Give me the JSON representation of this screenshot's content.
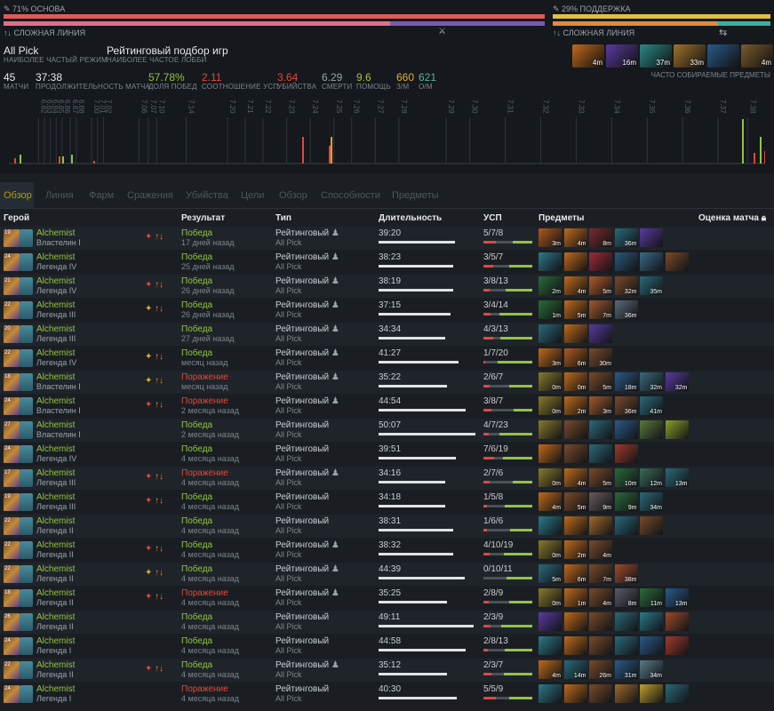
{
  "summary": {
    "core_pct": "71% ОСНОВА",
    "support_pct": "29% ПОДДЕРЖКА",
    "lane_left": "СЛОЖНАЯ ЛИНИЯ",
    "lane_right": "СЛОЖНАЯ ЛИНИЯ",
    "mode": "All Pick",
    "mode_sub": "НАИБОЛЕЕ ЧАСТЫЙ РЕЖИМ",
    "lobby": "Рейтинговый подбор игр",
    "lobby_sub": "НАИБОЛЕЕ ЧАСТОЕ ЛОББИ",
    "popular_items_label": "ЧАСТО СОБИРАЕМЫЕ ПРЕДМЕТЫ",
    "popular_items": [
      {
        "time": "4m",
        "color": "#c06a1a"
      },
      {
        "time": "16m",
        "color": "#5a3aa0"
      },
      {
        "time": "37m",
        "color": "#2a8a8a"
      },
      {
        "time": "33m",
        "color": "#a0742a"
      },
      {
        "time": "",
        "color": "#2a5a8a"
      },
      {
        "time": "4m",
        "color": "#7a5a2a"
      }
    ],
    "stats": [
      {
        "value": "45",
        "label": "МАТЧИ",
        "color": "#e6e9ec"
      },
      {
        "value": "37:38",
        "label": "ПРОДОЛЖИТЕЛЬНОСТЬ МАТЧА",
        "color": "#e6e9ec"
      },
      {
        "value": "57.78%",
        "label": "ДОЛЯ ПОБЕД",
        "color": "#92c442"
      },
      {
        "value": "2.11",
        "label": "СООТНОШЕНИЕ УСП",
        "color": "#e0483c"
      },
      {
        "value": "3.64",
        "label": "УБИЙСТВА",
        "color": "#e0483c"
      },
      {
        "value": "6.29",
        "label": "СМЕРТИ",
        "color": "#9aa3ad"
      },
      {
        "value": "9.6",
        "label": "ПОМОЩЬ",
        "color": "#aac03a"
      },
      {
        "value": "660",
        "label": "З/М",
        "color": "#e0b030"
      },
      {
        "value": "621",
        "label": "О/М",
        "color": "#5ab0a0"
      }
    ],
    "versions": [
      "6.82",
      "6.83",
      "6.84",
      "6.85",
      "6.86",
      "6.87",
      "6.88",
      "7.00",
      "7.01",
      "7.02",
      "7.06",
      "7.07",
      "7.10",
      "7.14",
      "7.20",
      "7.21",
      "7.22",
      "7.23",
      "7.24",
      "7.25",
      "7.26",
      "7.27",
      "7.28",
      "7.29",
      "7.30",
      "7.31",
      "7.32",
      "7.33",
      "7.34",
      "7.35",
      "7.36",
      "7.37",
      "7.38"
    ]
  },
  "tabs": [
    "Обзор",
    "Линия",
    "Фарм",
    "Сражения",
    "Убийства",
    "Цели",
    "Обзор",
    "Способности",
    "Предметы"
  ],
  "columns": {
    "hero": "Герой",
    "result": "Результат",
    "type": "Тип",
    "duration": "Длительность",
    "kda": "УСП",
    "items": "Предметы",
    "rating": "Оценка матча"
  },
  "matches": [
    {
      "level": "19",
      "hero": "Alchemist",
      "rank": "Властелин I",
      "role": "red",
      "result": "Победа",
      "win": true,
      "when": "17 дней назад",
      "type": "Рейтинговый",
      "party": true,
      "lobby": "All Pick",
      "duration": "39:20",
      "dur_frac": 0.78,
      "kda": "5/7/8",
      "items": [
        {
          "t": "3m",
          "c": "#b05a1a"
        },
        {
          "t": "4m",
          "c": "#c06a1a"
        },
        {
          "t": "8m",
          "c": "#7a2a2a"
        },
        {
          "t": "36m",
          "c": "#2a6a7a"
        },
        {
          "t": "",
          "c": "#5a3aa0"
        }
      ]
    },
    {
      "level": "24",
      "hero": "Alchemist",
      "rank": "Легенда IV",
      "role": "",
      "result": "Победа",
      "win": true,
      "when": "25 дней назад",
      "type": "Рейтинговый",
      "party": true,
      "lobby": "All Pick",
      "duration": "38:23",
      "dur_frac": 0.76,
      "kda": "3/5/7",
      "items": [
        {
          "t": "",
          "c": "#2a7a8a"
        },
        {
          "t": "",
          "c": "#c06a1a"
        },
        {
          "t": "",
          "c": "#a02a3a"
        },
        {
          "t": "",
          "c": "#2a5a7a"
        },
        {
          "t": "",
          "c": "#3a6a8a"
        },
        {
          "t": "",
          "c": "#7a4a2a"
        }
      ]
    },
    {
      "level": "21",
      "hero": "Alchemist",
      "rank": "Легенда IV",
      "role": "red",
      "result": "Победа",
      "win": true,
      "when": "26 дней назад",
      "type": "Рейтинговый",
      "party": true,
      "lobby": "All Pick",
      "duration": "38:19",
      "dur_frac": 0.76,
      "kda": "3/8/13",
      "items": [
        {
          "t": "2m",
          "c": "#2a6a3a"
        },
        {
          "t": "4m",
          "c": "#c06a1a"
        },
        {
          "t": "5m",
          "c": "#b05a2a"
        },
        {
          "t": "32m",
          "c": "#7a4a2a"
        },
        {
          "t": "35m",
          "c": "#2a6a7a"
        }
      ]
    },
    {
      "level": "22",
      "hero": "Alchemist",
      "rank": "Легенда III",
      "role": "yellow",
      "result": "Победа",
      "win": true,
      "when": "26 дней назад",
      "type": "Рейтинговый",
      "party": true,
      "lobby": "All Pick",
      "duration": "37:15",
      "dur_frac": 0.74,
      "kda": "3/4/14",
      "items": [
        {
          "t": "1m",
          "c": "#2a6a3a"
        },
        {
          "t": "5m",
          "c": "#c06a1a"
        },
        {
          "t": "7m",
          "c": "#a05a2a"
        },
        {
          "t": "36m",
          "c": "#5a6a7a"
        }
      ]
    },
    {
      "level": "20",
      "hero": "Alchemist",
      "rank": "Легенда III",
      "role": "",
      "result": "Победа",
      "win": true,
      "when": "27 дней назад",
      "type": "Рейтинговый",
      "party": true,
      "lobby": "All Pick",
      "duration": "34:34",
      "dur_frac": 0.68,
      "kda": "4/3/13",
      "items": [
        {
          "t": "",
          "c": "#2a6a7a"
        },
        {
          "t": "",
          "c": "#c06a1a"
        },
        {
          "t": "",
          "c": "#5a3aa0"
        }
      ]
    },
    {
      "level": "22",
      "hero": "Alchemist",
      "rank": "Легенда IV",
      "role": "yellow",
      "result": "Победа",
      "win": true,
      "when": "месяц назад",
      "type": "Рейтинговый",
      "party": true,
      "lobby": "All Pick",
      "duration": "41:27",
      "dur_frac": 0.82,
      "kda": "1/7/20",
      "items": [
        {
          "t": "3m",
          "c": "#c06a1a"
        },
        {
          "t": "6m",
          "c": "#b05a1a"
        },
        {
          "t": "30m",
          "c": "#7a4a2a"
        }
      ]
    },
    {
      "level": "18",
      "hero": "Alchemist",
      "rank": "Властелин I",
      "role": "yellow",
      "result": "Поражение",
      "win": false,
      "when": "месяц назад",
      "type": "Рейтинговый",
      "party": true,
      "lobby": "All Pick",
      "duration": "35:22",
      "dur_frac": 0.7,
      "kda": "2/6/7",
      "items": [
        {
          "t": "0m",
          "c": "#8a7a2a"
        },
        {
          "t": "0m",
          "c": "#c06a1a"
        },
        {
          "t": "5m",
          "c": "#7a4a2a"
        },
        {
          "t": "18m",
          "c": "#2a5a8a"
        },
        {
          "t": "32m",
          "c": "#3a6a7a"
        },
        {
          "t": "32m",
          "c": "#5a3aa0"
        }
      ]
    },
    {
      "level": "24",
      "hero": "Alchemist",
      "rank": "Властелин I",
      "role": "red",
      "result": "Поражение",
      "win": false,
      "when": "2 месяца назад",
      "type": "Рейтинговый",
      "party": true,
      "lobby": "All Pick",
      "duration": "44:54",
      "dur_frac": 0.89,
      "kda": "3/8/7",
      "items": [
        {
          "t": "0m",
          "c": "#8a7a2a"
        },
        {
          "t": "2m",
          "c": "#c06a1a"
        },
        {
          "t": "3m",
          "c": "#a05a2a"
        },
        {
          "t": "36m",
          "c": "#7a4a2a"
        },
        {
          "t": "41m",
          "c": "#2a6a7a"
        }
      ]
    },
    {
      "level": "27",
      "hero": "Alchemist",
      "rank": "Властелин I",
      "role": "",
      "result": "Победа",
      "win": true,
      "when": "2 месяца назад",
      "type": "Рейтинговый",
      "party": false,
      "lobby": "All Pick",
      "duration": "50:07",
      "dur_frac": 0.99,
      "kda": "4/7/23",
      "items": [
        {
          "t": "",
          "c": "#8a7a2a"
        },
        {
          "t": "",
          "c": "#7a4a2a"
        },
        {
          "t": "",
          "c": "#2a6a7a"
        },
        {
          "t": "",
          "c": "#2a5a8a"
        },
        {
          "t": "",
          "c": "#5a7a3a"
        },
        {
          "t": "",
          "c": "#8aa02a"
        }
      ]
    },
    {
      "level": "24",
      "hero": "Alchemist",
      "rank": "Легенда IV",
      "role": "",
      "result": "Победа",
      "win": true,
      "when": "4 месяца назад",
      "type": "Рейтинговый",
      "party": false,
      "lobby": "All Pick",
      "duration": "39:51",
      "dur_frac": 0.79,
      "kda": "7/6/19",
      "items": [
        {
          "t": "",
          "c": "#c06a1a"
        },
        {
          "t": "",
          "c": "#7a4a2a"
        },
        {
          "t": "",
          "c": "#2a6a7a"
        },
        {
          "t": "",
          "c": "#a03a2a"
        }
      ]
    },
    {
      "level": "17",
      "hero": "Alchemist",
      "rank": "Легенда III",
      "role": "red",
      "result": "Поражение",
      "win": false,
      "when": "4 месяца назад",
      "type": "Рейтинговый",
      "party": true,
      "lobby": "All Pick",
      "duration": "34:16",
      "dur_frac": 0.68,
      "kda": "2/7/6",
      "items": [
        {
          "t": "0m",
          "c": "#8a7a2a"
        },
        {
          "t": "4m",
          "c": "#c06a1a"
        },
        {
          "t": "5m",
          "c": "#7a4a2a"
        },
        {
          "t": "10m",
          "c": "#2a6a3a"
        },
        {
          "t": "12m",
          "c": "#3a6a5a"
        },
        {
          "t": "13m",
          "c": "#2a6a7a"
        }
      ]
    },
    {
      "level": "19",
      "hero": "Alchemist",
      "rank": "Легенда III",
      "role": "red",
      "result": "Победа",
      "win": true,
      "when": "4 месяца назад",
      "type": "Рейтинговый",
      "party": false,
      "lobby": "All Pick",
      "duration": "34:18",
      "dur_frac": 0.68,
      "kda": "1/5/8",
      "items": [
        {
          "t": "4m",
          "c": "#c06a1a"
        },
        {
          "t": "5m",
          "c": "#7a4a2a"
        },
        {
          "t": "9m",
          "c": "#6a5a5a"
        },
        {
          "t": "9m",
          "c": "#2a6a3a"
        },
        {
          "t": "34m",
          "c": "#2a6a7a"
        }
      ]
    },
    {
      "level": "22",
      "hero": "Alchemist",
      "rank": "Легенда II",
      "role": "",
      "result": "Победа",
      "win": true,
      "when": "4 месяца назад",
      "type": "Рейтинговый",
      "party": false,
      "lobby": "All Pick",
      "duration": "38:31",
      "dur_frac": 0.76,
      "kda": "1/6/6",
      "items": [
        {
          "t": "",
          "c": "#2a7a8a"
        },
        {
          "t": "",
          "c": "#c06a1a"
        },
        {
          "t": "",
          "c": "#a06a2a"
        },
        {
          "t": "",
          "c": "#2a6a7a"
        },
        {
          "t": "",
          "c": "#7a4a2a"
        }
      ]
    },
    {
      "level": "22",
      "hero": "Alchemist",
      "rank": "Легенда II",
      "role": "red",
      "result": "Победа",
      "win": true,
      "when": "4 месяца назад",
      "type": "Рейтинговый",
      "party": true,
      "lobby": "All Pick",
      "duration": "38:32",
      "dur_frac": 0.76,
      "kda": "4/10/19",
      "items": [
        {
          "t": "0m",
          "c": "#8a7a2a"
        },
        {
          "t": "2m",
          "c": "#c06a1a"
        },
        {
          "t": "4m",
          "c": "#7a4a2a"
        }
      ]
    },
    {
      "level": "22",
      "hero": "Alchemist",
      "rank": "Легенда II",
      "role": "yellow",
      "result": "Победа",
      "win": true,
      "when": "4 месяца назад",
      "type": "Рейтинговый",
      "party": true,
      "lobby": "All Pick",
      "duration": "44:39",
      "dur_frac": 0.88,
      "kda": "0/10/11",
      "items": [
        {
          "t": "5m",
          "c": "#2a6a7a"
        },
        {
          "t": "6m",
          "c": "#c06a1a"
        },
        {
          "t": "7m",
          "c": "#7a4a2a"
        },
        {
          "t": "38m",
          "c": "#a04a2a"
        }
      ]
    },
    {
      "level": "18",
      "hero": "Alchemist",
      "rank": "Легенда II",
      "role": "red",
      "result": "Поражение",
      "win": false,
      "when": "4 месяца назад",
      "type": "Рейтинговый",
      "party": true,
      "lobby": "All Pick",
      "duration": "35:25",
      "dur_frac": 0.7,
      "kda": "2/8/9",
      "items": [
        {
          "t": "0m",
          "c": "#8a7a2a"
        },
        {
          "t": "1m",
          "c": "#c06a1a"
        },
        {
          "t": "4m",
          "c": "#7a4a2a"
        },
        {
          "t": "8m",
          "c": "#5a5a6a"
        },
        {
          "t": "11m",
          "c": "#2a6a3a"
        },
        {
          "t": "13m",
          "c": "#2a5a8a"
        }
      ]
    },
    {
      "level": "26",
      "hero": "Alchemist",
      "rank": "Легенда II",
      "role": "",
      "result": "Победа",
      "win": true,
      "when": "4 месяца назад",
      "type": "Рейтинговый",
      "party": false,
      "lobby": "All Pick",
      "duration": "49:11",
      "dur_frac": 0.97,
      "kda": "2/3/9",
      "items": [
        {
          "t": "",
          "c": "#5a3aa0"
        },
        {
          "t": "",
          "c": "#c06a1a"
        },
        {
          "t": "",
          "c": "#7a4a2a"
        },
        {
          "t": "",
          "c": "#2a6a7a"
        },
        {
          "t": "",
          "c": "#2a7a8a"
        },
        {
          "t": "",
          "c": "#a04a2a"
        }
      ]
    },
    {
      "level": "24",
      "hero": "Alchemist",
      "rank": "Легенда I",
      "role": "",
      "result": "Победа",
      "win": true,
      "when": "4 месяца назад",
      "type": "Рейтинговый",
      "party": false,
      "lobby": "All Pick",
      "duration": "44:58",
      "dur_frac": 0.89,
      "kda": "2/8/13",
      "items": [
        {
          "t": "",
          "c": "#2a7a8a"
        },
        {
          "t": "",
          "c": "#c06a1a"
        },
        {
          "t": "",
          "c": "#7a4a2a"
        },
        {
          "t": "",
          "c": "#2a6a7a"
        },
        {
          "t": "",
          "c": "#2a5a8a"
        },
        {
          "t": "",
          "c": "#a03a2a"
        }
      ]
    },
    {
      "level": "22",
      "hero": "Alchemist",
      "rank": "Легенда II",
      "role": "red",
      "result": "Победа",
      "win": true,
      "when": "4 месяца назад",
      "type": "Рейтинговый",
      "party": true,
      "lobby": "All Pick",
      "duration": "35:12",
      "dur_frac": 0.7,
      "kda": "2/3/7",
      "items": [
        {
          "t": "4m",
          "c": "#c06a1a"
        },
        {
          "t": "14m",
          "c": "#2a6a7a"
        },
        {
          "t": "26m",
          "c": "#7a4a2a"
        },
        {
          "t": "31m",
          "c": "#2a5a8a"
        },
        {
          "t": "34m",
          "c": "#5a7a8a"
        }
      ]
    },
    {
      "level": "24",
      "hero": "Alchemist",
      "rank": "Легенда I",
      "role": "",
      "result": "Поражение",
      "win": false,
      "when": "4 месяца назад",
      "type": "Рейтинговый",
      "party": false,
      "lobby": "All Pick",
      "duration": "40:30",
      "dur_frac": 0.8,
      "kda": "5/5/9",
      "items": [
        {
          "t": "",
          "c": "#2a7a8a"
        },
        {
          "t": "",
          "c": "#c06a1a"
        },
        {
          "t": "",
          "c": "#7a4a2a"
        },
        {
          "t": "",
          "c": "#a06a2a"
        },
        {
          "t": "",
          "c": "#c0a02a"
        },
        {
          "t": "",
          "c": "#2a6a7a"
        }
      ]
    }
  ]
}
